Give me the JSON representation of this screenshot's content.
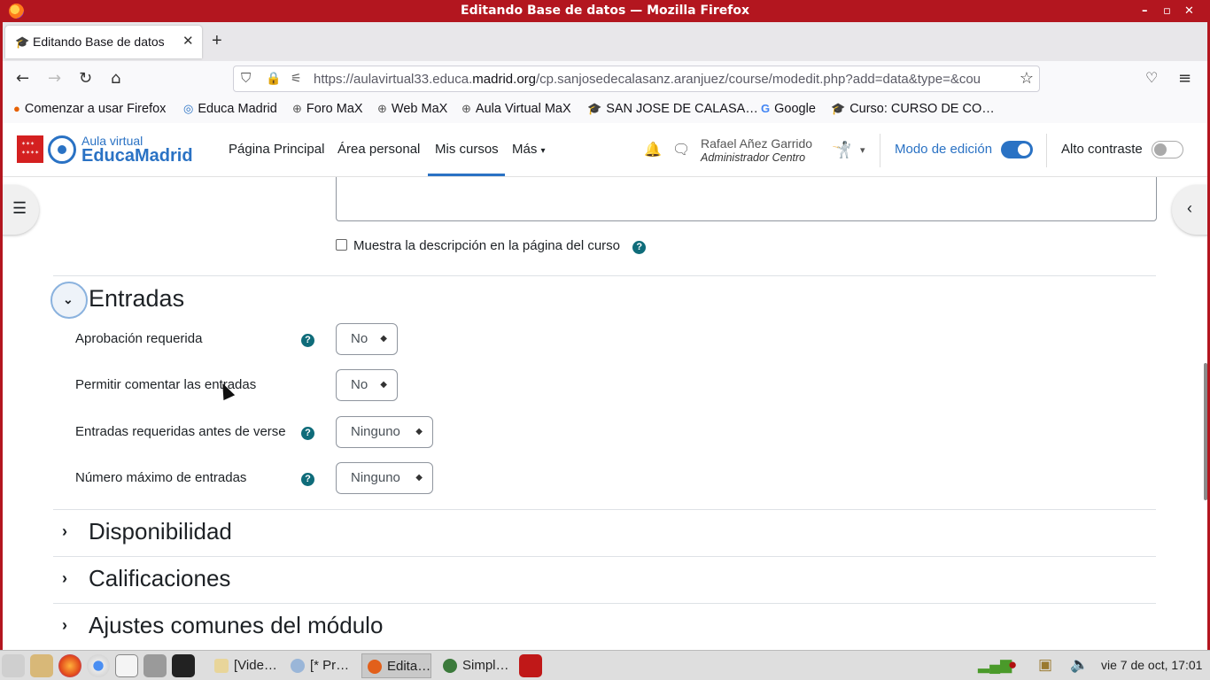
{
  "window": {
    "title": "Editando Base de datos — Mozilla Firefox",
    "controls": [
      "–",
      "▫",
      "✕"
    ]
  },
  "browser": {
    "tab_title": "Editando Base de datos",
    "url_prefix": "https://aulavirtual33.educa.",
    "url_domain": "madrid.org",
    "url_suffix": "/cp.sanjosedecalasanz.aranjuez/course/modedit.php?add=data&type=&cou",
    "bookmarks": [
      {
        "label": "Comenzar a usar Firefox",
        "icon": "firefox-icon"
      },
      {
        "label": "Educa Madrid",
        "icon": "educamadrid-icon"
      },
      {
        "label": "Foro MaX",
        "icon": "globe-icon"
      },
      {
        "label": "Web MaX",
        "icon": "globe-icon"
      },
      {
        "label": "Aula Virtual MaX",
        "icon": "globe-icon"
      },
      {
        "label": "SAN JOSE DE CALASA…",
        "icon": "moodle-icon"
      },
      {
        "label": "Google",
        "icon": "google-icon"
      },
      {
        "label": "Curso: CURSO DE CO…",
        "icon": "moodle-icon"
      }
    ]
  },
  "header": {
    "logo_small": "Aula virtual",
    "logo_big": "EducaMadrid",
    "nav": [
      "Página Principal",
      "Área personal",
      "Mis cursos",
      "Más"
    ],
    "active_nav": "Mis cursos",
    "user_name": "Rafael Añez Garrido",
    "user_role": "Administrador Centro",
    "edit_mode_label": "Modo de edición",
    "edit_mode_on": true,
    "high_contrast_label": "Alto contraste",
    "high_contrast_on": false,
    "accent_color": "#2a72c4"
  },
  "form": {
    "show_description_label": "Muestra la descripción en la página del curso",
    "entries_section": "Entradas",
    "fields": [
      {
        "label": "Aprobación requerida",
        "value": "No",
        "help": true
      },
      {
        "label": "Permitir comentar las entradas",
        "value": "No",
        "help": false
      },
      {
        "label": "Entradas requeridas antes de verse",
        "value": "Ninguno",
        "help": true
      },
      {
        "label": "Número máximo de entradas",
        "value": "Ninguno",
        "help": true
      }
    ],
    "collapsed_sections": [
      "Disponibilidad",
      "Calificaciones",
      "Ajustes comunes del módulo"
    ]
  },
  "taskbar": {
    "items": [
      "[Vide…",
      "[* Pr…",
      "Edita…",
      "Simpl…"
    ],
    "clock": "vie 7 de oct, 17:01"
  }
}
